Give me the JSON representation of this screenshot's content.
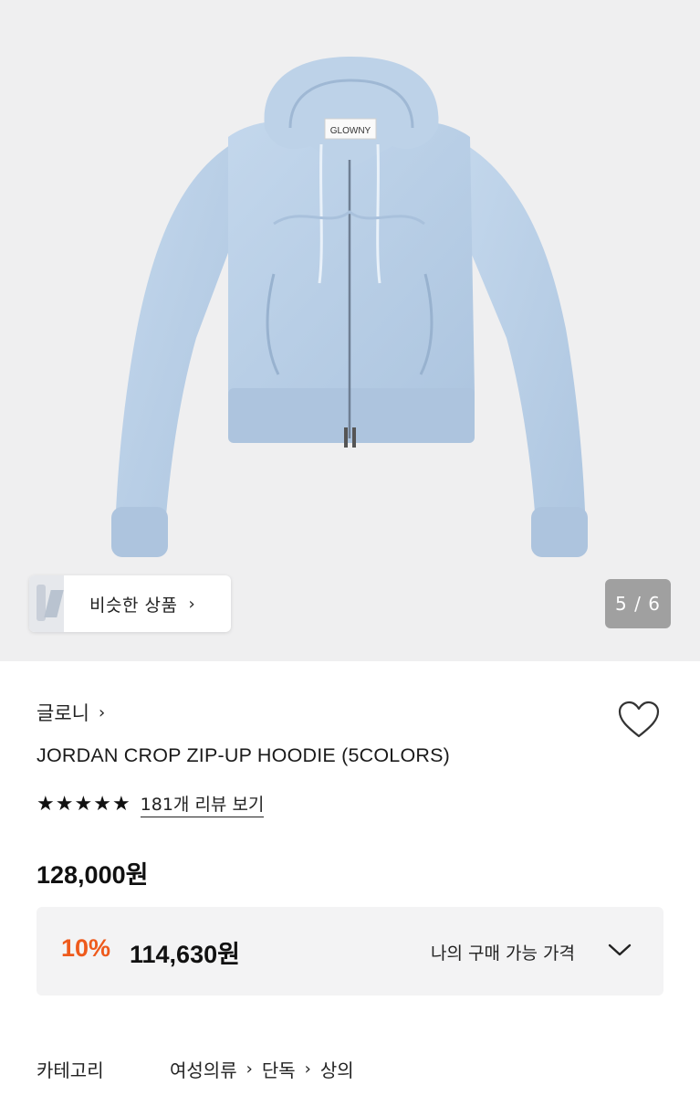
{
  "gallery": {
    "tag_label": "GLOWNY",
    "similar_products_label": "비슷한 상품",
    "counter": "5 / 6"
  },
  "product": {
    "brand": "글로니",
    "title": "JORDAN CROP ZIP-UP HOODIE (5COLORS)",
    "rating_stars": 5,
    "review_link": "181개 리뷰 보기",
    "price": "128,000원",
    "discount": {
      "percent": "10%",
      "price": "114,630원",
      "my_price_label": "나의 구매 가능 가격"
    },
    "category": {
      "label": "카테고리",
      "path": [
        "여성의류",
        "단독",
        "상의"
      ]
    }
  },
  "colors": {
    "hoodie": "#b9cfe6",
    "discount_accent": "#ee5a1c"
  }
}
